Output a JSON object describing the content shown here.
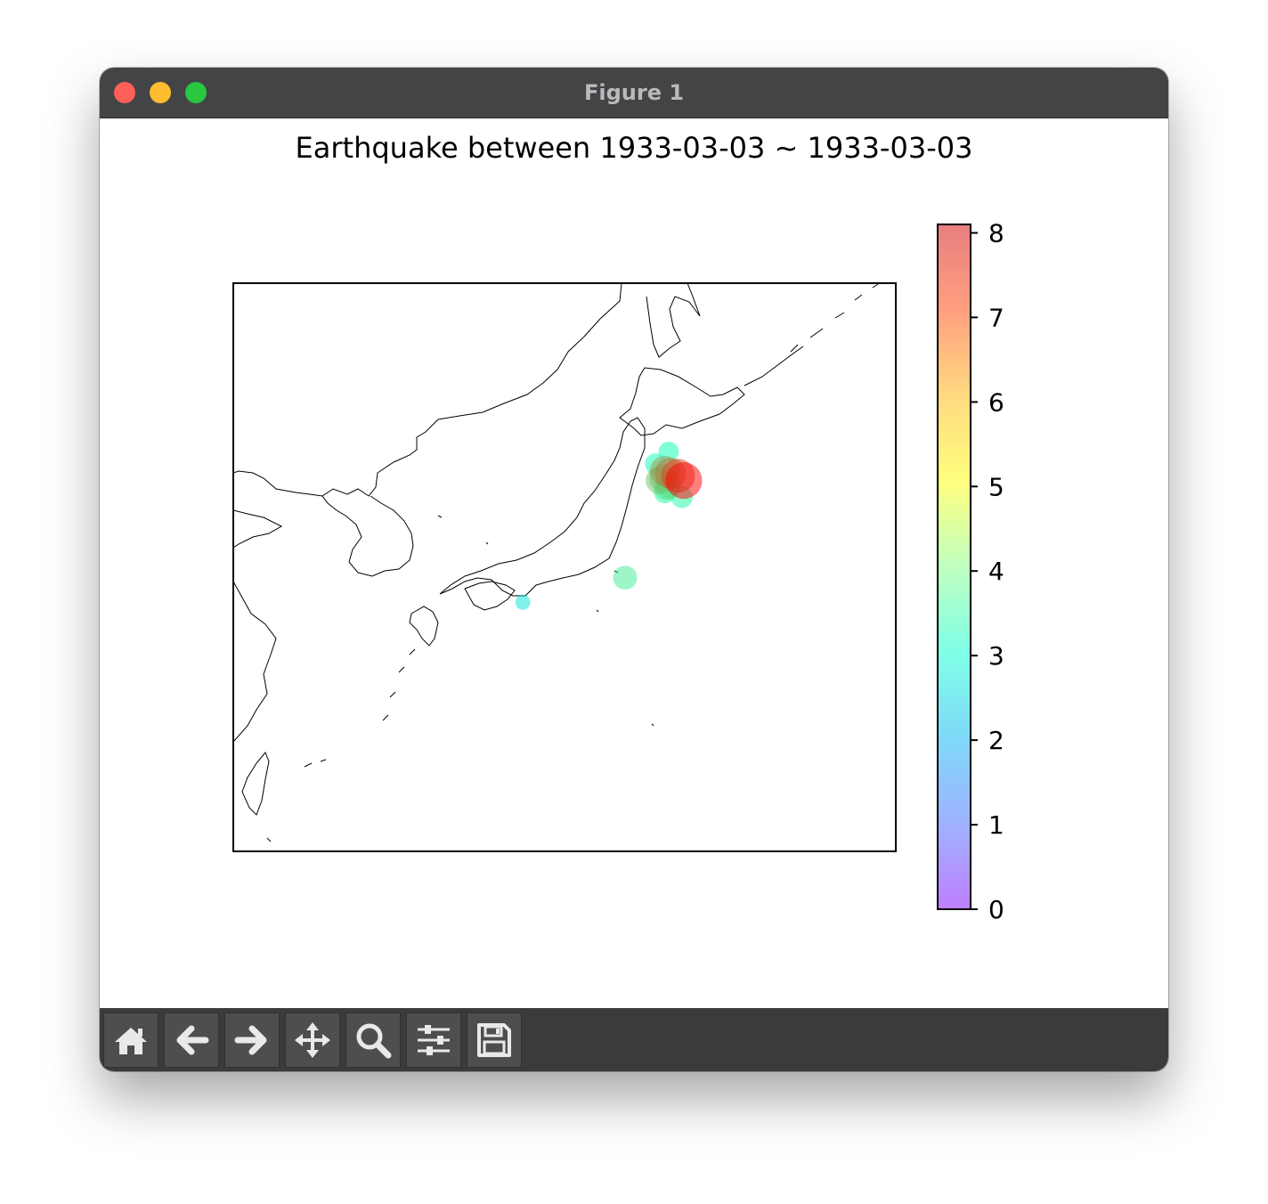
{
  "window": {
    "title": "Figure 1"
  },
  "toolbar": {
    "buttons": [
      {
        "name": "home-button",
        "icon": "home-icon"
      },
      {
        "name": "back-button",
        "icon": "arrow-left-icon"
      },
      {
        "name": "forward-button",
        "icon": "arrow-right-icon"
      },
      {
        "name": "pan-button",
        "icon": "move-icon"
      },
      {
        "name": "zoom-button",
        "icon": "magnifier-icon"
      },
      {
        "name": "configure-subplots-button",
        "icon": "sliders-icon"
      },
      {
        "name": "save-button",
        "icon": "floppy-disk-icon"
      }
    ]
  },
  "chart_data": {
    "type": "scatter",
    "title": "Earthquake between 1933-03-03 ~ 1933-03-03",
    "colorbar": {
      "range": [
        0,
        8.1
      ],
      "ticks": [
        "0",
        "1",
        "2",
        "3",
        "4",
        "5",
        "6",
        "7",
        "8"
      ],
      "colormap": "rainbow",
      "alpha": 0.5
    },
    "map": {
      "projection": "mercator",
      "lon_range": [
        120,
        155
      ],
      "lat_range": [
        22,
        47
      ],
      "coastlines": true
    },
    "points": [
      {
        "lon": 143.8,
        "lat": 39.2,
        "mag": 8.1
      },
      {
        "lon": 143.5,
        "lat": 39.4,
        "mag": 7.4
      },
      {
        "lon": 143.1,
        "lat": 39.5,
        "mag": 6.8
      },
      {
        "lon": 142.8,
        "lat": 39.6,
        "mag": 6.5
      },
      {
        "lon": 142.7,
        "lat": 39.3,
        "mag": 5.9
      },
      {
        "lon": 142.5,
        "lat": 39.2,
        "mag": 5.8
      },
      {
        "lon": 143.0,
        "lat": 39.0,
        "mag": 5.4
      },
      {
        "lon": 142.9,
        "lat": 38.9,
        "mag": 5.3
      },
      {
        "lon": 142.8,
        "lat": 38.7,
        "mag": 4.5
      },
      {
        "lon": 143.7,
        "lat": 38.5,
        "mag": 4.5
      },
      {
        "lon": 142.3,
        "lat": 39.9,
        "mag": 4.2
      },
      {
        "lon": 143.0,
        "lat": 40.4,
        "mag": 4.1
      },
      {
        "lon": 140.7,
        "lat": 35.0,
        "mag": 5.0
      },
      {
        "lon": 135.3,
        "lat": 33.9,
        "mag": 2.8
      }
    ]
  }
}
